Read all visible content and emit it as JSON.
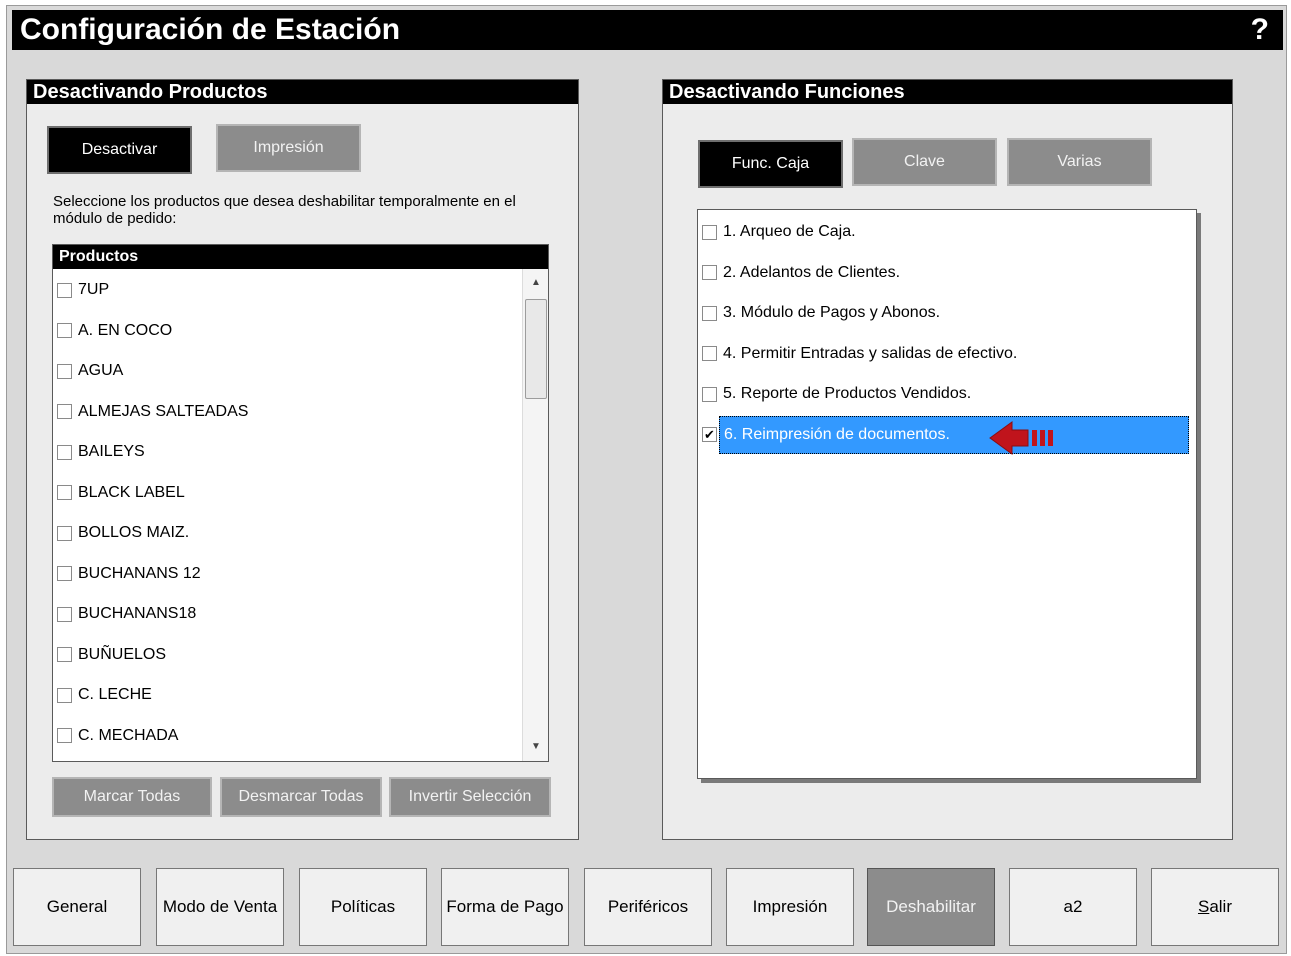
{
  "window": {
    "title": "Configuración de Estación",
    "help": "?"
  },
  "left_panel": {
    "header": "Desactivando Productos",
    "tabs": {
      "desactivar": "Desactivar",
      "impresion": "Impresión"
    },
    "description": "Seleccione los productos que desea deshabilitar temporalmente en el módulo de pedido:",
    "list_header": "Productos",
    "products": [
      {
        "label": "7UP",
        "checked": false
      },
      {
        "label": "A. EN COCO",
        "checked": false
      },
      {
        "label": "AGUA",
        "checked": false
      },
      {
        "label": "ALMEJAS SALTEADAS",
        "checked": false
      },
      {
        "label": "BAILEYS",
        "checked": false
      },
      {
        "label": "BLACK LABEL",
        "checked": false
      },
      {
        "label": "BOLLOS MAIZ.",
        "checked": false
      },
      {
        "label": "BUCHANANS 12",
        "checked": false
      },
      {
        "label": "BUCHANANS18",
        "checked": false
      },
      {
        "label": "BUÑUELOS",
        "checked": false
      },
      {
        "label": "C. LECHE",
        "checked": false
      },
      {
        "label": "C. MECHADA",
        "checked": false
      }
    ],
    "actions": {
      "marcar": "Marcar Todas",
      "desmarcar": "Desmarcar Todas",
      "invertir": "Invertir Selección"
    }
  },
  "right_panel": {
    "header": "Desactivando Funciones",
    "tabs": {
      "func_caja": "Func. Caja",
      "clave": "Clave",
      "varias": "Varias"
    },
    "functions": [
      {
        "label": "1. Arqueo de Caja.",
        "checked": false
      },
      {
        "label": "2. Adelantos de Clientes.",
        "checked": false
      },
      {
        "label": "3. Módulo de Pagos y Abonos.",
        "checked": false
      },
      {
        "label": "4. Permitir Entradas y salidas de efectivo.",
        "checked": false
      },
      {
        "label": "5. Reporte de Productos Vendidos.",
        "checked": false
      },
      {
        "label": "6. Reimpresión de documentos.",
        "checked": true
      }
    ]
  },
  "bottom_nav": {
    "general": "General",
    "modo_venta": "Modo de Venta",
    "politicas": "Políticas",
    "forma_pago": "Forma de Pago",
    "perifericos": "Periféricos",
    "impresion": "Impresión",
    "deshabilitar": "Deshabilitar",
    "a2": "a2",
    "salir_first": "S",
    "salir_rest": "alir"
  },
  "colors": {
    "selection": "#3399ff",
    "arrow": "#c0141c",
    "title_bg": "#000000",
    "panel_bg": "#ececec"
  }
}
